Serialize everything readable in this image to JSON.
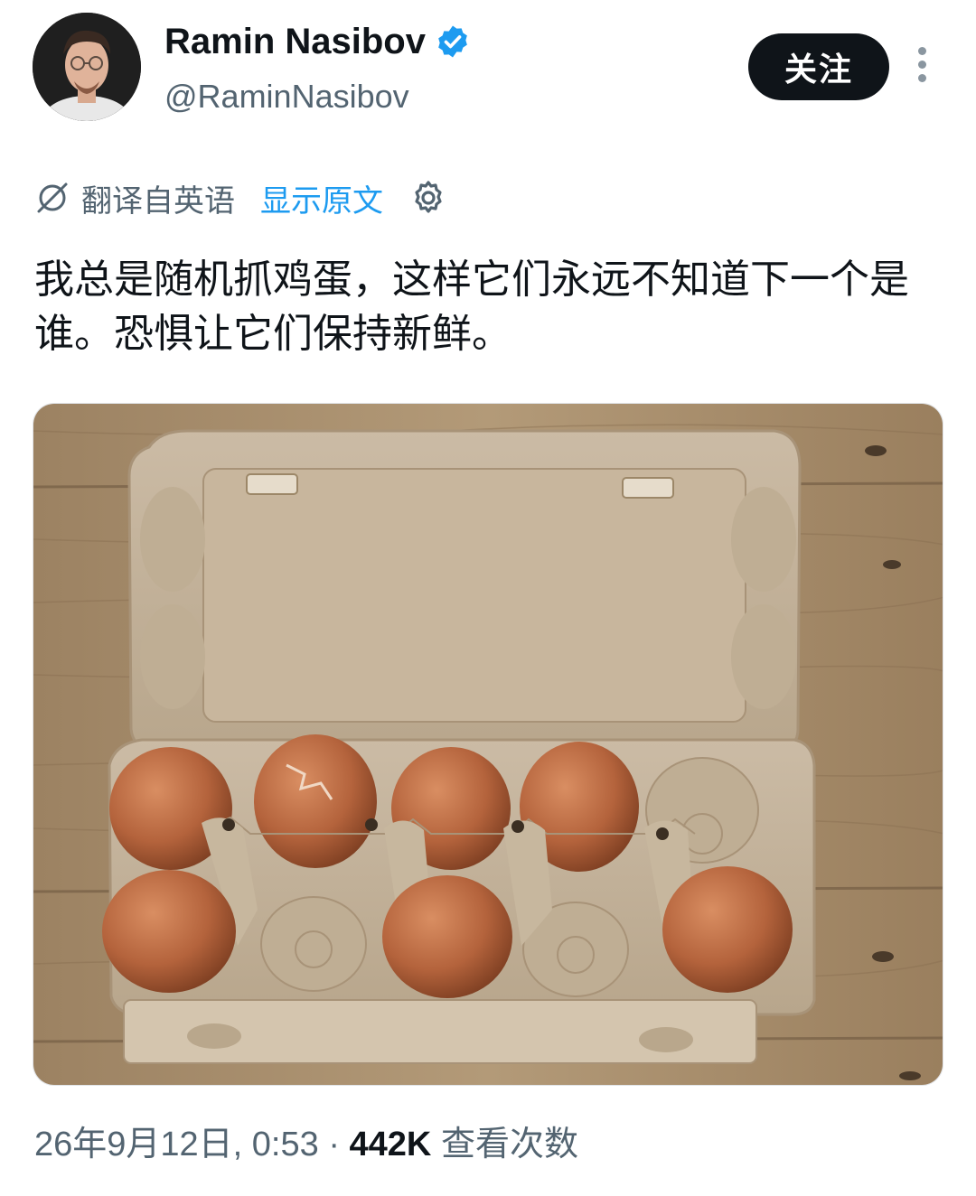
{
  "author": {
    "name": "Ramin Nasibov",
    "handle": "@RaminNasibov",
    "verified": true,
    "verified_color": "#1d9bf0"
  },
  "actions": {
    "follow_label": "关注",
    "more_icon": "more-vertical-icon"
  },
  "translation": {
    "icon": "translate-icon",
    "label": "翻译自英语",
    "show_original": "显示原文",
    "settings_icon": "gear-icon"
  },
  "tweet": {
    "text": "我总是随机抓鸡蛋，这样它们永远不知道下一个是谁。恐惧让它们保持新鲜。"
  },
  "media": {
    "icon": "photo-eggs-carton"
  },
  "meta": {
    "date": "26年9月12日, 0:53",
    "separator": "·",
    "views": "442K",
    "views_label": "查看次数"
  },
  "colors": {
    "text_primary": "#0f1419",
    "text_secondary": "#536471",
    "link": "#1d9bf0"
  }
}
